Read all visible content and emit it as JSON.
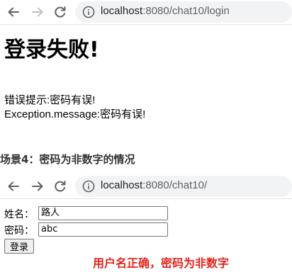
{
  "top_browser": {
    "url_host": "localhost",
    "url_path": ":8080/chat10/login"
  },
  "login_failed_page": {
    "heading": "登录失败!",
    "error_hint": "错误提示:密码有误!",
    "exception_message": "Exception.message:密码有误!"
  },
  "scene": {
    "title": "场景4：密码为非数字的情况"
  },
  "bottom_browser": {
    "url_host": "localhost",
    "url_path": ":8080/chat10/"
  },
  "login_form": {
    "username_label": "姓名：",
    "username_value": "路人",
    "password_label": "密码：",
    "password_value": "abc",
    "submit_label": "登录"
  },
  "annotation": {
    "text": "用户名正确，密码为非数字",
    "color": "#e8231c"
  },
  "icons": [
    "back-arrow-icon",
    "forward-arrow-icon",
    "reload-icon",
    "info-icon"
  ]
}
